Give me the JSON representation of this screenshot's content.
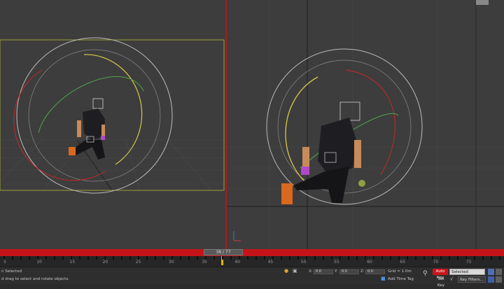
{
  "viewports": {
    "left": {
      "label": ""
    },
    "right": {
      "label": ""
    }
  },
  "timeline": {
    "frame_display": "38 / 77",
    "ticks": [
      "5",
      "10",
      "15",
      "20",
      "25",
      "30",
      "35",
      "40",
      "45",
      "50",
      "55",
      "60",
      "65",
      "70",
      "75"
    ]
  },
  "status": {
    "selection_text": "n Selected",
    "prompt_text": "d drag to select and rotate objects.",
    "x_label": "X:",
    "x_value": "0.0",
    "y_label": "Y:",
    "y_value": "0.0",
    "z_label": "Z:",
    "z_value": "0.0",
    "grid_text": "Grid = 1.0m",
    "add_time_tag": "Add Time Tag"
  },
  "animation": {
    "auto_key": "Auto Key",
    "selected_option": "Selected",
    "set_key": "Set Key",
    "key_filters": "Key Filters..."
  },
  "colors": {
    "accent_red": "#c41418",
    "viewport_bg": "#3d3d3d",
    "trajectory_yellow": "#d8c84a",
    "trajectory_green": "#4fa64a",
    "trajectory_red": "#c8282a"
  }
}
